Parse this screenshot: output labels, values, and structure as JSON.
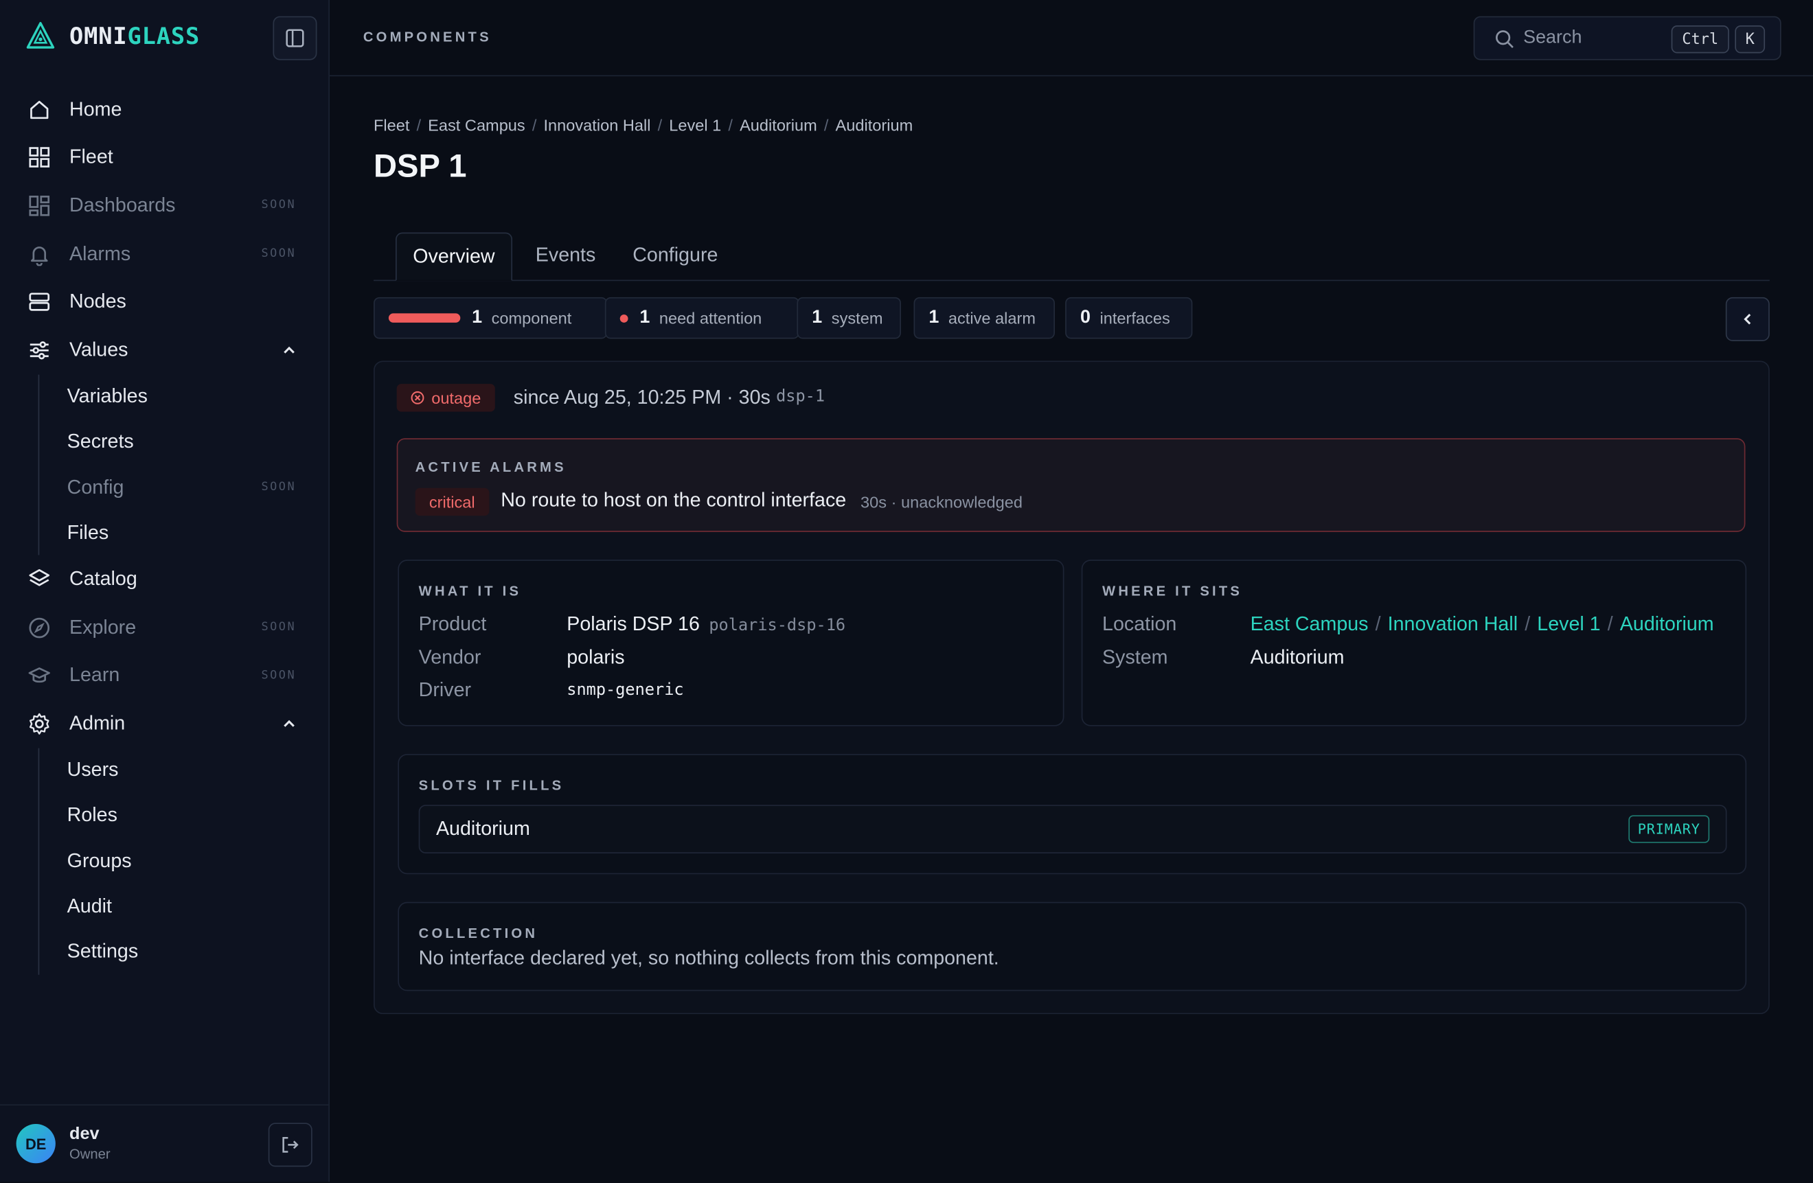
{
  "app": {
    "logo_a": "OMNI",
    "logo_b": "GLASS"
  },
  "sidebar": {
    "items": [
      {
        "label": "Home",
        "icon": "home-icon"
      },
      {
        "label": "Fleet",
        "icon": "grid-icon"
      },
      {
        "label": "Dashboards",
        "icon": "dashboard-icon",
        "badge": "SOON"
      },
      {
        "label": "Alarms",
        "icon": "bell-icon",
        "badge": "SOON"
      },
      {
        "label": "Nodes",
        "icon": "server-icon"
      },
      {
        "label": "Values",
        "icon": "sliders-icon",
        "expanded": true
      },
      {
        "label": "Catalog",
        "icon": "layers-icon"
      },
      {
        "label": "Explore",
        "icon": "compass-icon",
        "badge": "SOON"
      },
      {
        "label": "Learn",
        "icon": "graduation-cap-icon",
        "badge": "SOON"
      },
      {
        "label": "Admin",
        "icon": "gear-icon",
        "expanded": true
      }
    ],
    "values_sub": [
      {
        "label": "Variables"
      },
      {
        "label": "Secrets"
      },
      {
        "label": "Config",
        "badge": "SOON"
      },
      {
        "label": "Files"
      }
    ],
    "admin_sub": [
      {
        "label": "Users"
      },
      {
        "label": "Roles"
      },
      {
        "label": "Groups"
      },
      {
        "label": "Audit"
      },
      {
        "label": "Settings"
      }
    ],
    "user": {
      "initials": "DE",
      "name": "dev",
      "role": "Owner"
    }
  },
  "header": {
    "section": "COMPONENTS",
    "search_placeholder": "Search",
    "shortcut": [
      "Ctrl",
      "K"
    ]
  },
  "breadcrumb": [
    "Fleet",
    "East Campus",
    "Innovation Hall",
    "Level 1",
    "Auditorium",
    "Auditorium"
  ],
  "page_title": "DSP 1",
  "tabs": [
    "Overview",
    "Events",
    "Configure"
  ],
  "active_tab": "Overview",
  "summary": [
    {
      "num": "1",
      "label": "component"
    },
    {
      "num": "1",
      "label": "need attention"
    },
    {
      "num": "1",
      "label": "system"
    },
    {
      "num": "1",
      "label": "active alarm"
    },
    {
      "num": "0",
      "label": "interfaces"
    }
  ],
  "status": {
    "state": "outage",
    "since": "since Aug 25, 10:25 PM · 30s",
    "slug": "dsp-1"
  },
  "active_alarms": {
    "heading": "ACTIVE ALARMS",
    "items": [
      {
        "severity": "critical",
        "message": "No route to host on the control interface",
        "meta": "30s · unacknowledged"
      }
    ]
  },
  "what_it_is": {
    "heading": "WHAT IT IS",
    "product_label": "Product",
    "product": "Polaris DSP 16",
    "product_id": "polaris-dsp-16",
    "vendor_label": "Vendor",
    "vendor": "polaris",
    "driver_label": "Driver",
    "driver": "snmp-generic"
  },
  "where_it_sits": {
    "heading": "WHERE IT SITS",
    "location_label": "Location",
    "location": [
      "East Campus",
      "Innovation Hall",
      "Level 1",
      "Auditorium"
    ],
    "system_label": "System",
    "system": "Auditorium"
  },
  "slots": {
    "heading": "SLOTS IT FILLS",
    "items": [
      {
        "name": "Auditorium",
        "badge": "PRIMARY"
      }
    ]
  },
  "collection": {
    "heading": "COLLECTION",
    "text": "No interface declared yet, so nothing collects from this component."
  },
  "colors": {
    "accent": "#2dd4bf",
    "danger": "#ef5b5b",
    "background": "#090d16"
  }
}
